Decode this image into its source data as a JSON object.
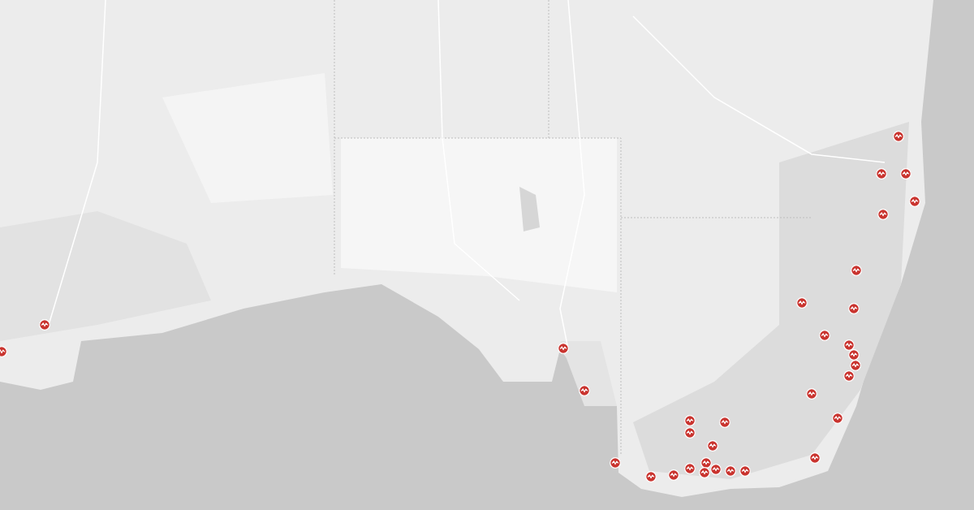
{
  "markers": [
    {
      "kind": "pulse"
    },
    {
      "kind": "pulse"
    },
    {
      "kind": "pulse"
    },
    {
      "kind": "pulse"
    },
    {
      "kind": "pulse"
    },
    {
      "kind": "pulse"
    },
    {
      "kind": "pulse"
    },
    {
      "kind": "pulse"
    },
    {
      "kind": "pulse"
    },
    {
      "kind": "pulse"
    },
    {
      "kind": "pulse"
    },
    {
      "kind": "pulse"
    },
    {
      "kind": "pulse"
    },
    {
      "kind": "pulse"
    },
    {
      "kind": "pulse"
    },
    {
      "kind": "pulse"
    },
    {
      "kind": "pulse"
    },
    {
      "kind": "pulse"
    },
    {
      "kind": "pulse"
    },
    {
      "kind": "pulse"
    },
    {
      "kind": "pulse"
    },
    {
      "kind": "pulse"
    },
    {
      "kind": "pulse"
    },
    {
      "kind": "pulse"
    },
    {
      "kind": "pulse"
    },
    {
      "kind": "pulse"
    },
    {
      "kind": "pulse"
    },
    {
      "kind": "pulse"
    },
    {
      "kind": "pulse"
    },
    {
      "kind": "pulse"
    },
    {
      "kind": "pulse"
    },
    {
      "kind": "pulse"
    },
    {
      "kind": "pulse"
    }
  ]
}
